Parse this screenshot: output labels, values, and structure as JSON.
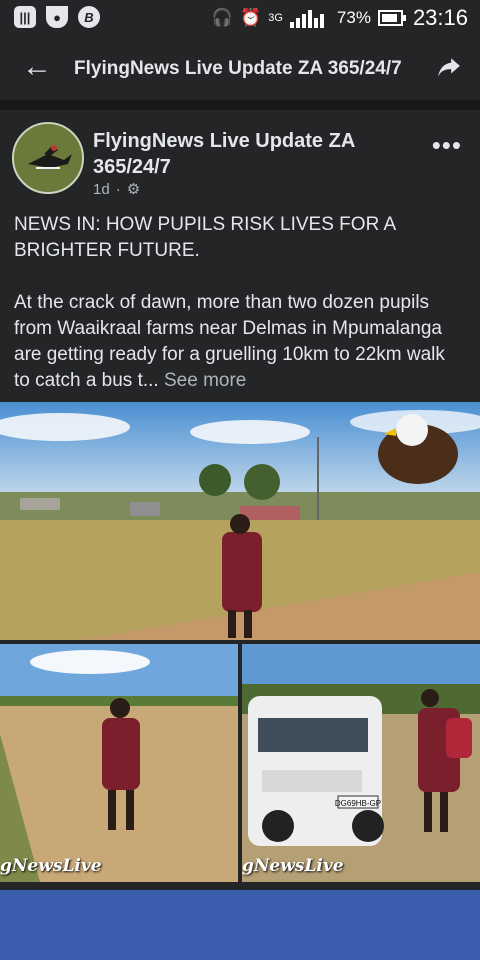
{
  "statusbar": {
    "time": "23:16",
    "battery": "73%",
    "network": "3G"
  },
  "topbar": {
    "title": "FlyingNews Live Update ZA 365/24/7"
  },
  "post": {
    "page_name": "FlyingNews Live Update ZA 365/24/7",
    "age": "1d",
    "text": "NEWS IN: HOW PUPILS RISK LIVES FOR A BRIGHTER FUTURE.",
    "body": "At the crack of dawn, more than two dozen pupils from Waaikraal farms near Delmas in Mpumalanga are getting ready for a gruelling 10km to 22km walk to catch a bus t...",
    "see_more": "See more"
  },
  "photos": {
    "watermark": "gNewsLive",
    "plate": "DG69HB-GP"
  },
  "colors": {
    "background": "#242526",
    "accent": "#3b5fae"
  }
}
